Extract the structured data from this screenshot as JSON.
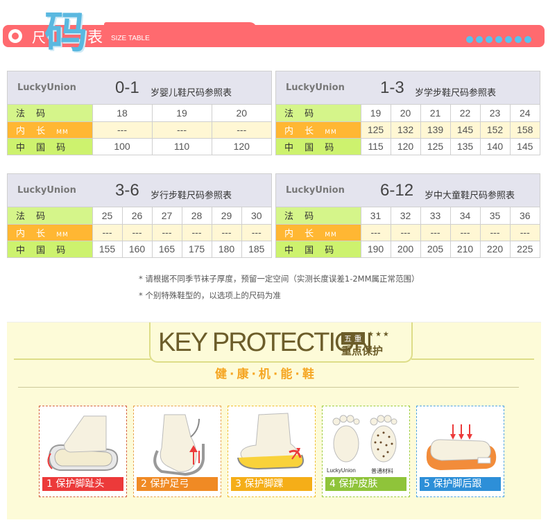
{
  "header": {
    "chi": "尺",
    "ma": "码",
    "biao": "表",
    "english": "SIZE TABLE",
    "dot_count": 7
  },
  "tables": [
    {
      "brand": "LuckyUnion",
      "age": "0-1",
      "desc": "岁婴儿鞋尺码参照表",
      "fa_label": "法 码",
      "nei_label": "内 长",
      "unit": "MM",
      "zh_label": "中 国 码",
      "fa": [
        "18",
        "19",
        "20"
      ],
      "nei": [
        "---",
        "---",
        "---"
      ],
      "zh": [
        "100",
        "110",
        "120"
      ]
    },
    {
      "brand": "LuckyUnion",
      "age": "1-3",
      "desc": "岁学步鞋尺码参照表",
      "fa_label": "法 码",
      "nei_label": "内 长",
      "unit": "MM",
      "zh_label": "中 国 码",
      "fa": [
        "19",
        "20",
        "21",
        "22",
        "23",
        "24"
      ],
      "nei": [
        "125",
        "132",
        "139",
        "145",
        "152",
        "158"
      ],
      "zh": [
        "115",
        "120",
        "125",
        "135",
        "140",
        "145"
      ]
    },
    {
      "brand": "LuckyUnion",
      "age": "3-6",
      "desc": "岁行步鞋尺码参照表",
      "fa_label": "法 码",
      "nei_label": "内 长",
      "unit": "MM",
      "zh_label": "中 国 码",
      "fa": [
        "25",
        "26",
        "27",
        "28",
        "29",
        "30"
      ],
      "nei": [
        "---",
        "---",
        "---",
        "---",
        "---",
        "---"
      ],
      "zh": [
        "155",
        "160",
        "165",
        "175",
        "180",
        "185"
      ]
    },
    {
      "brand": "LuckyUnion",
      "age": "6-12",
      "desc": "岁中大童鞋尺码参照表",
      "fa_label": "法 码",
      "nei_label": "内 长",
      "unit": "MM",
      "zh_label": "中 国 码",
      "fa": [
        "31",
        "32",
        "33",
        "34",
        "35",
        "36"
      ],
      "nei": [
        "---",
        "---",
        "---",
        "---",
        "---",
        "---"
      ],
      "zh": [
        "190",
        "200",
        "205",
        "210",
        "220",
        "225"
      ]
    }
  ],
  "notes": [
    "* 请根据不同季节袜子厚度，预留一定空间（实测长度误差1-2MM属正常范围）",
    "* 个别特殊鞋型的，以选项上的尺码为准"
  ],
  "protection": {
    "title": "KEY PROTECTION",
    "five": "五 重",
    "stars": "★★★",
    "subtitle": "重点保护",
    "healthy": "健·康·机·能·鞋",
    "cards": [
      {
        "caption": "1 保护脚趾头",
        "icon": "toe-protection-icon"
      },
      {
        "caption": "2  保护足弓",
        "icon": "arch-protection-icon"
      },
      {
        "caption": "3  保护脚踝",
        "icon": "ankle-protection-icon"
      },
      {
        "caption": "4  保护皮肤",
        "icon": "skin-protection-icon",
        "label_a": "LuckyUnion",
        "label_b": "普通材料"
      },
      {
        "caption": "5 保护脚后跟",
        "icon": "heel-protection-icon"
      }
    ]
  }
}
